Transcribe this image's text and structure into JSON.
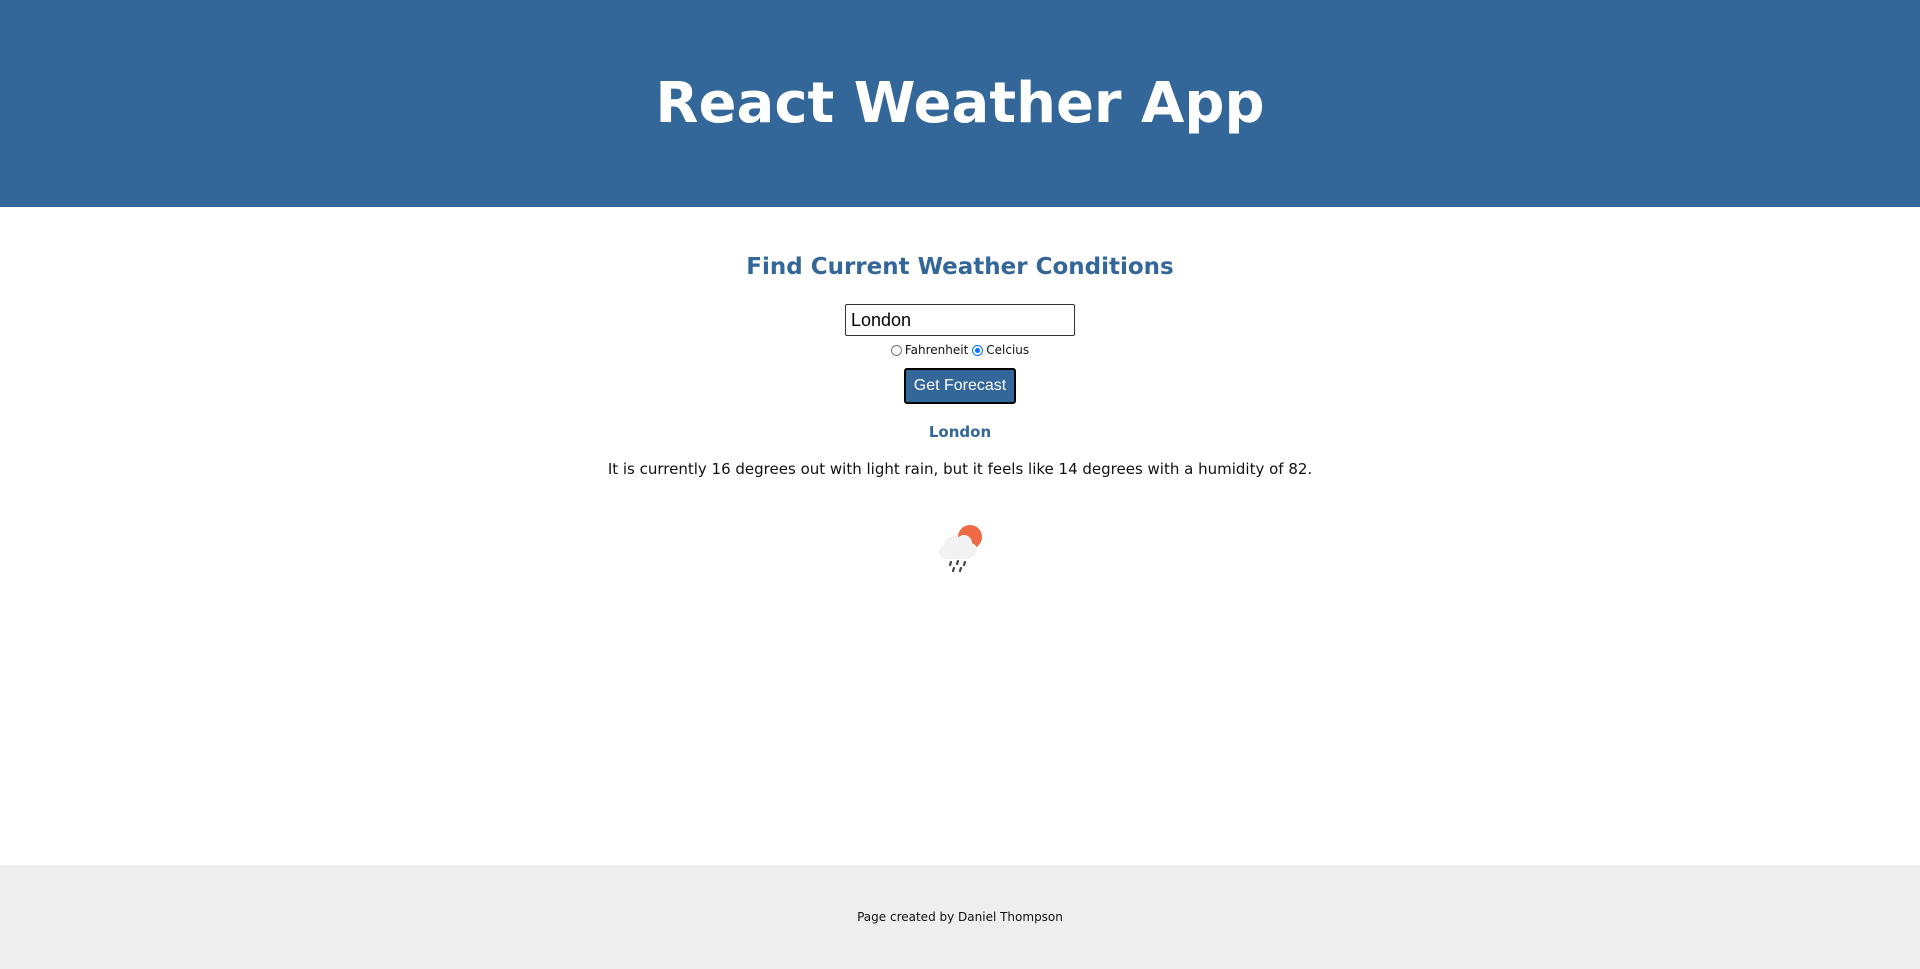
{
  "header": {
    "title": "React Weather App"
  },
  "search": {
    "heading": "Find Current Weather Conditions",
    "city_value": "London",
    "units": [
      {
        "label": "Fahrenheit",
        "checked": false
      },
      {
        "label": "Celcius",
        "checked": true
      }
    ],
    "button_label": "Get Forecast"
  },
  "result": {
    "city": "London",
    "description": "It is currently 16 degrees out with light rain, but it feels like 14 degrees with a humidity of 82.",
    "icon": "light-rain-partly-sunny-icon"
  },
  "footer": {
    "text": "Page created by Daniel Thompson"
  },
  "colors": {
    "brand": "#336699",
    "footer_bg": "#eeeeee",
    "sun": "#ee6a44"
  }
}
